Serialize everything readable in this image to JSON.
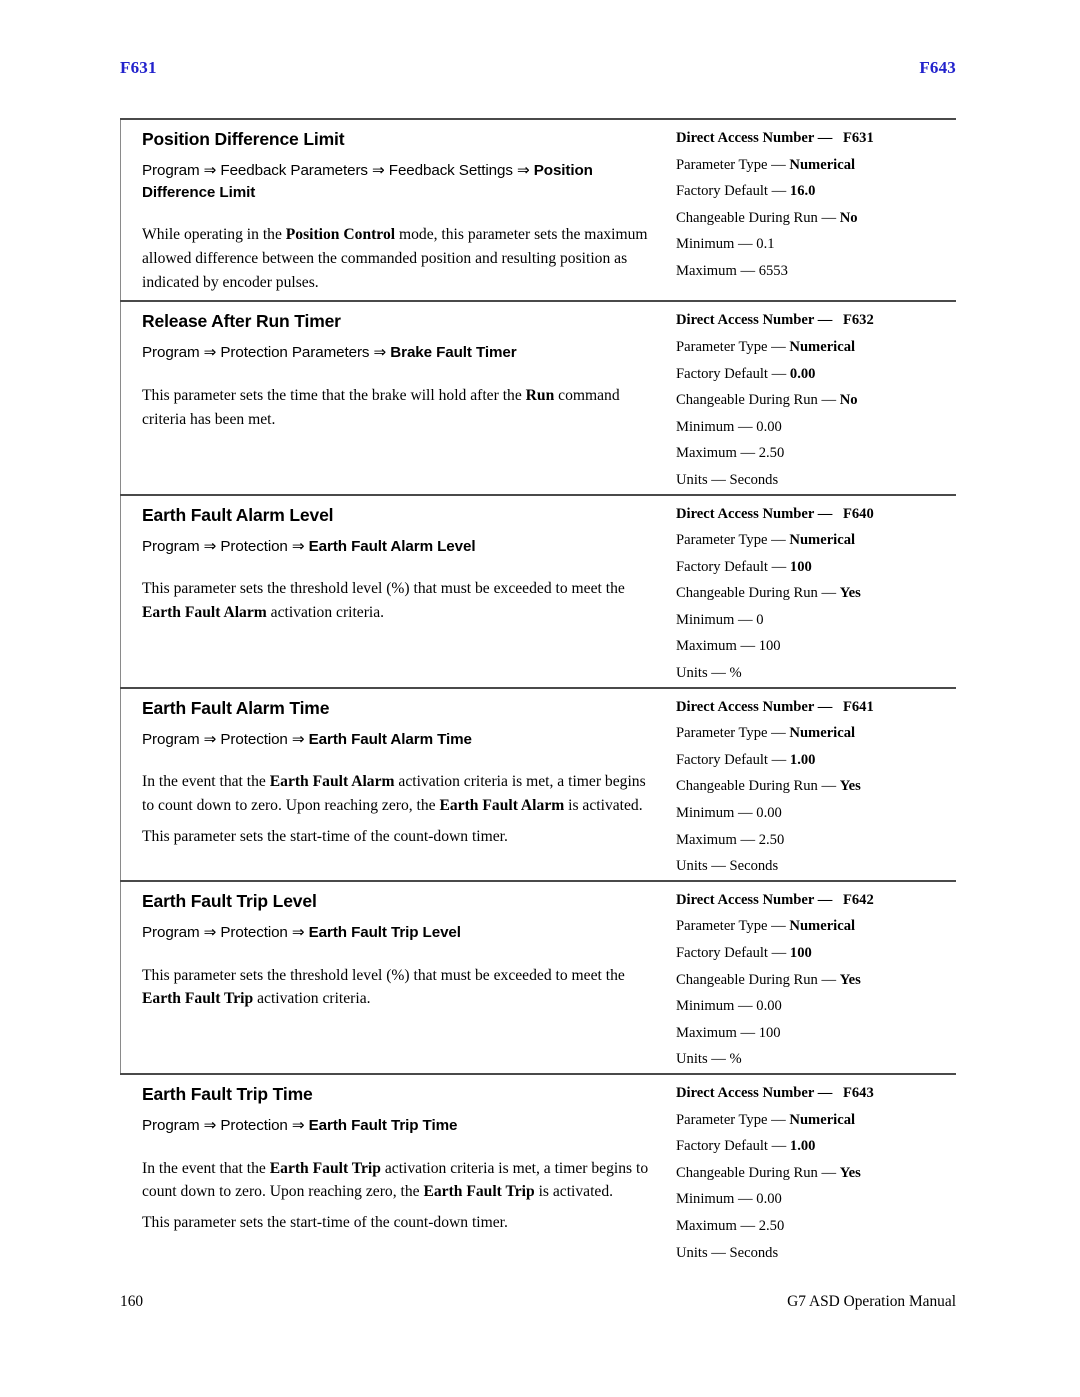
{
  "running_head": {
    "left": "F631",
    "right": "F643",
    "color": "#2222cc"
  },
  "footer": {
    "page_number": "160",
    "manual_title": "G7 ASD Operation Manual"
  },
  "labels": {
    "direct_access_number": "Direct Access Number —",
    "parameter_type": "Parameter Type —",
    "factory_default": "Factory Default —",
    "changeable_during_run": "Changeable During Run —",
    "minimum": "Minimum —",
    "maximum": "Maximum —",
    "units": "Units —"
  },
  "sections": [
    {
      "title": "Position Difference Limit",
      "path_prefix": "Program ⇒ Feedback Parameters ⇒ Feedback Settings ⇒ ",
      "path_bold": "Position Difference Limit",
      "paragraphs": [
        "While operating in the |Position Control| mode, this parameter sets the maximum allowed difference between the commanded position and resulting position as indicated by encoder pulses."
      ],
      "spec": {
        "direct_access_number": "F631",
        "parameter_type": "Numerical",
        "factory_default": "16.0",
        "changeable_during_run": "No",
        "minimum": "0.1",
        "maximum": "6553",
        "units": null
      }
    },
    {
      "title": "Release After Run Timer",
      "path_prefix": "Program ⇒ Protection Parameters ⇒ ",
      "path_bold": "Brake Fault Timer",
      "paragraphs": [
        "This parameter sets the time that the brake will hold after the |Run| command criteria has been met."
      ],
      "spec": {
        "direct_access_number": "F632",
        "parameter_type": "Numerical",
        "factory_default": "0.00",
        "changeable_during_run": "No",
        "minimum": "0.00",
        "maximum": "2.50",
        "units": "Seconds"
      }
    },
    {
      "title": "Earth Fault Alarm Level",
      "path_prefix": "Program ⇒ Protection ⇒ ",
      "path_bold": "Earth Fault Alarm Level",
      "paragraphs": [
        "This parameter sets the threshold level (%) that must be exceeded to meet the |Earth Fault Alarm| activation criteria."
      ],
      "spec": {
        "direct_access_number": "F640",
        "parameter_type": "Numerical",
        "factory_default": "100",
        "changeable_during_run": "Yes",
        "minimum": "0",
        "maximum": "100",
        "units": "%"
      }
    },
    {
      "title": "Earth Fault Alarm Time",
      "path_prefix": "Program ⇒ Protection ⇒ ",
      "path_bold": "Earth Fault Alarm Time",
      "paragraphs": [
        "In the event that the |Earth Fault Alarm| activation criteria is met, a timer begins to count down to zero. Upon reaching zero, the |Earth Fault Alarm| is activated.",
        "This parameter sets the start-time of the count-down timer."
      ],
      "spec": {
        "direct_access_number": "F641",
        "parameter_type": "Numerical",
        "factory_default": "1.00",
        "changeable_during_run": "Yes",
        "minimum": "0.00",
        "maximum": "2.50",
        "units": "Seconds"
      }
    },
    {
      "title": "Earth Fault Trip Level",
      "path_prefix": "Program ⇒ Protection ⇒ ",
      "path_bold": "Earth Fault Trip Level",
      "paragraphs": [
        "This parameter sets the threshold level (%) that must be exceeded to meet the |Earth Fault Trip| activation criteria."
      ],
      "spec": {
        "direct_access_number": "F642",
        "parameter_type": "Numerical",
        "factory_default": "100",
        "changeable_during_run": "Yes",
        "minimum": "0.00",
        "maximum": "100",
        "units": "%"
      }
    },
    {
      "title": "Earth Fault Trip Time",
      "path_prefix": "Program ⇒ Protection ⇒ ",
      "path_bold": "Earth Fault Trip Time",
      "paragraphs": [
        "In the event that the |Earth Fault Trip| activation criteria is met, a timer begins to count down to zero. Upon reaching zero, the |Earth Fault Trip| is activated.",
        "This parameter sets the start-time of the count-down timer."
      ],
      "spec": {
        "direct_access_number": "F643",
        "parameter_type": "Numerical",
        "factory_default": "1.00",
        "changeable_during_run": "Yes",
        "minimum": "0.00",
        "maximum": "2.50",
        "units": "Seconds"
      }
    }
  ]
}
